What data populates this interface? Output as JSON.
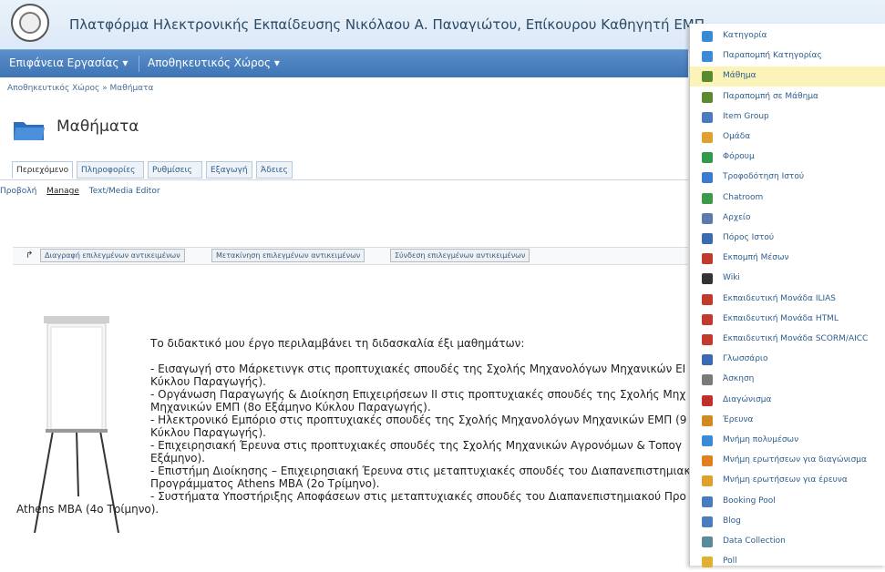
{
  "header": {
    "title": "Πλατφόρμα Ηλεκτρονικής Εκπαίδευσης Νικόλαου Α. Παναγιώτου, Επίκουρου Καθηγητή ΕΜΠ"
  },
  "mainnav": {
    "workspace": "Επιφάνεια Εργασίας ▾",
    "repository": "Αποθηκευτικός Χώρος ▾"
  },
  "breadcrumb": {
    "item1": "Αποθηκευτικός Χώρος",
    "sep": " » ",
    "item2": "Μαθήματα"
  },
  "page": {
    "title": "Μαθήματα"
  },
  "tabs": [
    "Περιεχόμενο",
    "Πληροφορίες",
    "Ρυθμίσεις",
    "Εξαγωγή",
    "Άδειες"
  ],
  "subtabs": [
    "Προβολή",
    "Manage",
    "Text/Media Editor"
  ],
  "actions": [
    "Διαγραφή επιλεγμένων αντικειμένων",
    "Μετακίνηση επιλεγμένων αντικειμένων",
    "Σύνδεση επιλεγμένων αντικειμένων"
  ],
  "content": {
    "lines": [
      "Το διδακτικό μου έργο περιλαμβάνει τη διδασκαλία έξι μαθημάτων:",
      "- Εισαγωγή στο Μάρκετινγκ στις προπτυχιακές σπουδές της Σχολής Μηχανολόγων Μηχανικών ΕΙ",
      "Κύκλου Παραγωγής).",
      "- Οργάνωση Παραγωγής & Διοίκηση Επιχειρήσεων ΙΙ στις προπτυχιακές σπουδές της Σχολής Μηχ",
      "Μηχανικών ΕΜΠ (8ο Εξάμηνο Κύκλου Παραγωγής).",
      "- Ηλεκτρονικό Εμπόριο στις προπτυχιακές σπουδές της Σχολής Μηχανολόγων Μηχανικών ΕΜΠ (9",
      "Κύκλου Παραγωγής).",
      "- Επιχειρησιακή Έρευνα στις προπτυχιακές σπουδές της Σχολής Μηχανικών Αγρονόμων & Τοπογ",
      "Εξάμηνο).",
      "- Επιστήμη Διοίκησης – Επιχειρησιακή Έρευνα στις μεταπτυχιακές σπουδές του Διαπανεπιστημιακ",
      "Προγράμματος Athens MBA (2ο Τρίμηνο).",
      "- Συστήματα Υποστήριξης Αποφάσεων στις μεταπτυχιακές σπουδές του Διαπανεπιστημιακού Προ",
      "Athens MBA (4ο Τρίμηνο)."
    ]
  },
  "menu": {
    "highlighted": "Μάθημα",
    "items": [
      {
        "label": "Κατηγορία",
        "icon": "folder-icon",
        "color": "#3a8ad6"
      },
      {
        "label": "Παραπομπή Κατηγορίας",
        "icon": "folder-link-icon",
        "color": "#3a8ad6"
      },
      {
        "label": "Μάθημα",
        "icon": "course-icon",
        "color": "#5a8a2e"
      },
      {
        "label": "Παραπομπή σε Μάθημα",
        "icon": "course-link-icon",
        "color": "#5a8a2e"
      },
      {
        "label": "Item Group",
        "icon": "item-group-icon",
        "color": "#4a7cc0"
      },
      {
        "label": "Ομάδα",
        "icon": "group-icon",
        "color": "#e0a030"
      },
      {
        "label": "Φόρουμ",
        "icon": "forum-icon",
        "color": "#2e9a4a"
      },
      {
        "label": "Τροφοδότηση Ιστού",
        "icon": "feed-icon",
        "color": "#3a7ad0"
      },
      {
        "label": "Chatroom",
        "icon": "chat-icon",
        "color": "#3a9a4a"
      },
      {
        "label": "Αρχείο",
        "icon": "file-icon",
        "color": "#5a7ab0"
      },
      {
        "label": "Πόρος Ιστού",
        "icon": "web-resource-icon",
        "color": "#3a6ab0"
      },
      {
        "label": "Εκπομπή Μέσων",
        "icon": "media-cast-icon",
        "color": "#c03a2e"
      },
      {
        "label": "Wiki",
        "icon": "wiki-icon",
        "color": "#333333"
      },
      {
        "label": "Εκπαιδευτική Μονάδα ILIAS",
        "icon": "learning-module-icon",
        "color": "#c03a2e"
      },
      {
        "label": "Εκπαιδευτική Μονάδα HTML",
        "icon": "html-module-icon",
        "color": "#c03a2e"
      },
      {
        "label": "Εκπαιδευτική Μονάδα SCORM/AICC",
        "icon": "scorm-module-icon",
        "color": "#c03a2e"
      },
      {
        "label": "Γλωσσάριο",
        "icon": "glossary-icon",
        "color": "#3a6ab0"
      },
      {
        "label": "Άσκηση",
        "icon": "exercise-icon",
        "color": "#7a7a7a"
      },
      {
        "label": "Διαγώνισμα",
        "icon": "test-icon",
        "color": "#c0302e"
      },
      {
        "label": "Έρευνα",
        "icon": "survey-icon",
        "color": "#d08a20"
      },
      {
        "label": "Μνήμη πολυμέσων",
        "icon": "media-pool-icon",
        "color": "#3a8ad6"
      },
      {
        "label": "Μνήμη ερωτήσεων για διαγώνισμα",
        "icon": "test-question-pool-icon",
        "color": "#e08020"
      },
      {
        "label": "Μνήμη ερωτήσεων για έρευνα",
        "icon": "survey-question-pool-icon",
        "color": "#e0a030"
      },
      {
        "label": "Booking Pool",
        "icon": "booking-pool-icon",
        "color": "#4a7cc0"
      },
      {
        "label": "Blog",
        "icon": "blog-icon",
        "color": "#4a7cc0"
      },
      {
        "label": "Data Collection",
        "icon": "data-collection-icon",
        "color": "#5a8a9e"
      },
      {
        "label": "Poll",
        "icon": "poll-icon",
        "color": "#e0b030"
      }
    ]
  }
}
